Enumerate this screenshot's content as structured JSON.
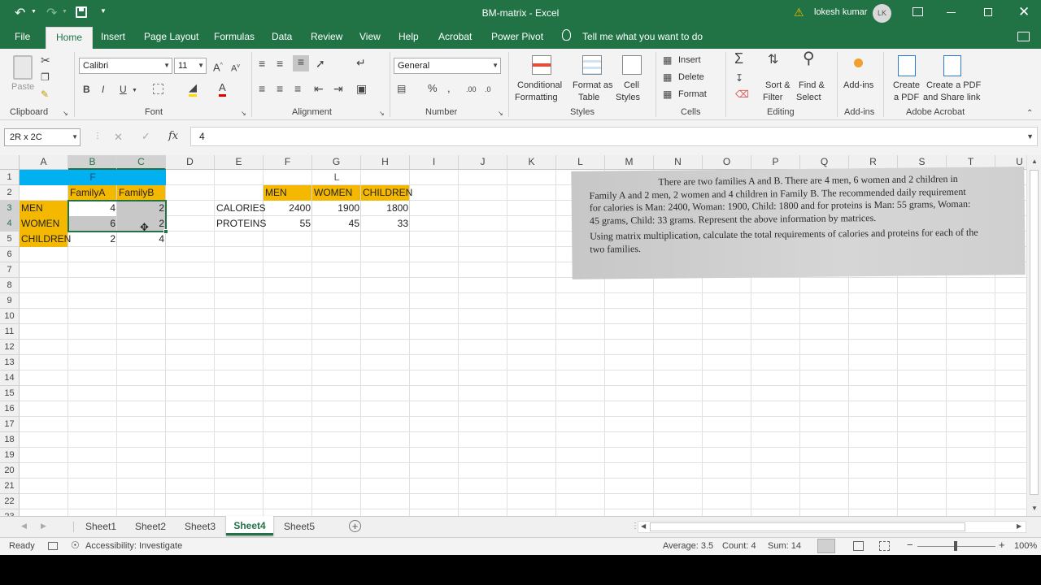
{
  "title_bar": {
    "doc_title": "BM-matrix  -  Excel",
    "user_name": "lokesh kumar",
    "user_initials": "LK"
  },
  "tabs": [
    "File",
    "Home",
    "Insert",
    "Page Layout",
    "Formulas",
    "Data",
    "Review",
    "View",
    "Help",
    "Acrobat",
    "Power Pivot"
  ],
  "tell_me": "Tell me what you want to do",
  "ribbon": {
    "clipboard": {
      "paste": "Paste",
      "label": "Clipboard"
    },
    "font": {
      "name": "Calibri",
      "size": "11",
      "label": "Font"
    },
    "alignment": {
      "label": "Alignment"
    },
    "number": {
      "format": "General",
      "label": "Number"
    },
    "styles": {
      "conditional_1": "Conditional",
      "conditional_2": "Formatting",
      "format_as_1": "Format as",
      "format_as_2": "Table",
      "cell_1": "Cell",
      "cell_2": "Styles",
      "label": "Styles"
    },
    "cells": {
      "insert": "Insert",
      "delete": "Delete",
      "format": "Format",
      "label": "Cells"
    },
    "editing": {
      "sort_1": "Sort &",
      "sort_2": "Filter",
      "find_1": "Find &",
      "find_2": "Select",
      "label": "Editing"
    },
    "addins": {
      "button": "Add-ins",
      "label": "Add-ins"
    },
    "acrobat": {
      "create_1": "Create",
      "create_2": "a PDF",
      "share_1": "Create a PDF",
      "share_2": "and Share link",
      "label": "Adobe Acrobat"
    }
  },
  "formula_bar": {
    "name_box": "2R x 2C",
    "value": "4",
    "fx": "fx"
  },
  "columns": [
    "A",
    "B",
    "C",
    "D",
    "E",
    "F",
    "G",
    "H",
    "I",
    "J",
    "K",
    "L",
    "M",
    "N",
    "O",
    "P",
    "Q",
    "R",
    "S",
    "T",
    "U"
  ],
  "rows": [
    "1",
    "2",
    "3",
    "4",
    "5",
    "6",
    "7",
    "8",
    "9",
    "10",
    "11",
    "12",
    "13",
    "14",
    "15",
    "16",
    "17",
    "18",
    "19",
    "20",
    "21",
    "22",
    "23"
  ],
  "cells": {
    "B1_F": "F",
    "B2": "FamilyA",
    "C2": "FamilyB",
    "A3": "MEN",
    "B3": "4",
    "C3": "2",
    "A4": "WOMEN",
    "B4": "6",
    "C4": "2",
    "A5": "CHILDREN",
    "B5": "2",
    "C5": "4",
    "G1_L": "L",
    "F2": "MEN",
    "G2": "WOMEN",
    "H2": "CHILDREN",
    "E3": "CALORIES",
    "F3": "2400",
    "G3": "1900",
    "H3": "1800",
    "E4": "PROTEINS",
    "F4": "55",
    "G4": "45",
    "H4": "33"
  },
  "problem_text": {
    "line1": "There are two families A and B. There are 4 men, 6 women and 2 children in",
    "line2": "Family A and 2 men, 2 women and 4 children in Family B. The recommended daily requirement",
    "line3": "for calories is Man: 2400, Woman: 1900, Child: 1800 and for proteins is Man: 55 grams, Woman:",
    "line4": "45 grams, Child: 33 grams. Represent the above information by matrices.",
    "line5": "Using matrix multiplication, calculate the total requirements of calories and proteins for each of the",
    "line6": "two families."
  },
  "sheets": [
    "Sheet1",
    "Sheet2",
    "Sheet3",
    "Sheet4",
    "Sheet5"
  ],
  "active_sheet": "Sheet4",
  "status": {
    "ready": "Ready",
    "accessibility": "Accessibility: Investigate",
    "average": "Average: 3.5",
    "count": "Count: 4",
    "sum": "Sum: 14",
    "zoom": "100%"
  },
  "colors": {
    "excel_green": "#217346",
    "yellow": "#f5b800",
    "blue": "#00b0f0",
    "selection": "#c8c8c8"
  }
}
